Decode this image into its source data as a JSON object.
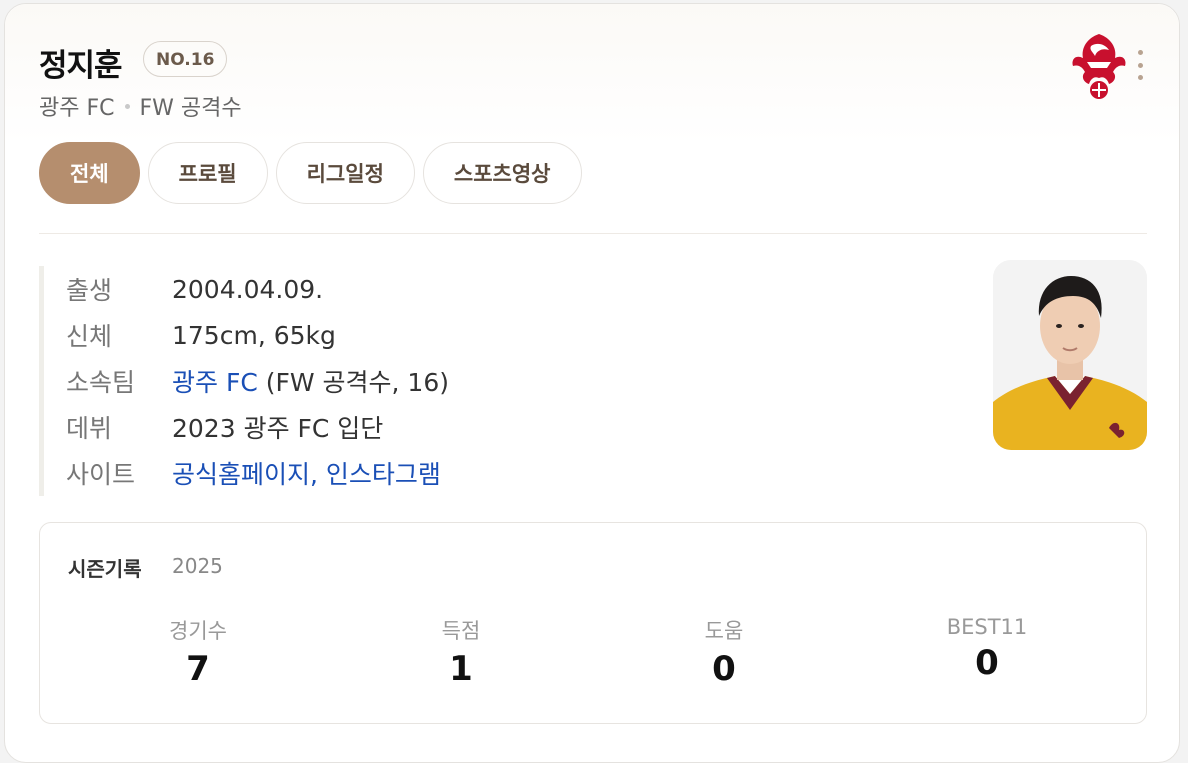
{
  "player": {
    "name": "정지훈",
    "number": "NO.16",
    "team": "광주 FC",
    "position": "FW 공격수"
  },
  "tabs": [
    {
      "label": "전체",
      "active": true
    },
    {
      "label": "프로필",
      "active": false
    },
    {
      "label": "리그일정",
      "active": false
    },
    {
      "label": "스포츠영상",
      "active": false
    }
  ],
  "profile": {
    "birth_label": "출생",
    "birth_value": "2004.04.09.",
    "body_label": "신체",
    "body_value": "175cm, 65kg",
    "team_label": "소속팀",
    "team_link": "광주 FC",
    "team_detail": " (FW 공격수, 16)",
    "debut_label": "데뷔",
    "debut_value": "2023 광주 FC 입단",
    "site_label": "사이트",
    "site_link1": "공식홈페이지",
    "site_sep": ", ",
    "site_link2": "인스타그램"
  },
  "season": {
    "title": "시즌기록",
    "year": "2025",
    "stats": [
      {
        "label": "경기수",
        "value": "7"
      },
      {
        "label": "득점",
        "value": "1"
      },
      {
        "label": "도움",
        "value": "0"
      },
      {
        "label": "BEST11",
        "value": "0"
      }
    ]
  },
  "icons": {
    "logo": "gwangju-fc-phoenix-logo",
    "more": "more-vertical-icon"
  },
  "colors": {
    "accent": "#b58e6e",
    "link": "#1a4fb6",
    "logo_red": "#c8102e",
    "jersey": "#e9b320"
  }
}
